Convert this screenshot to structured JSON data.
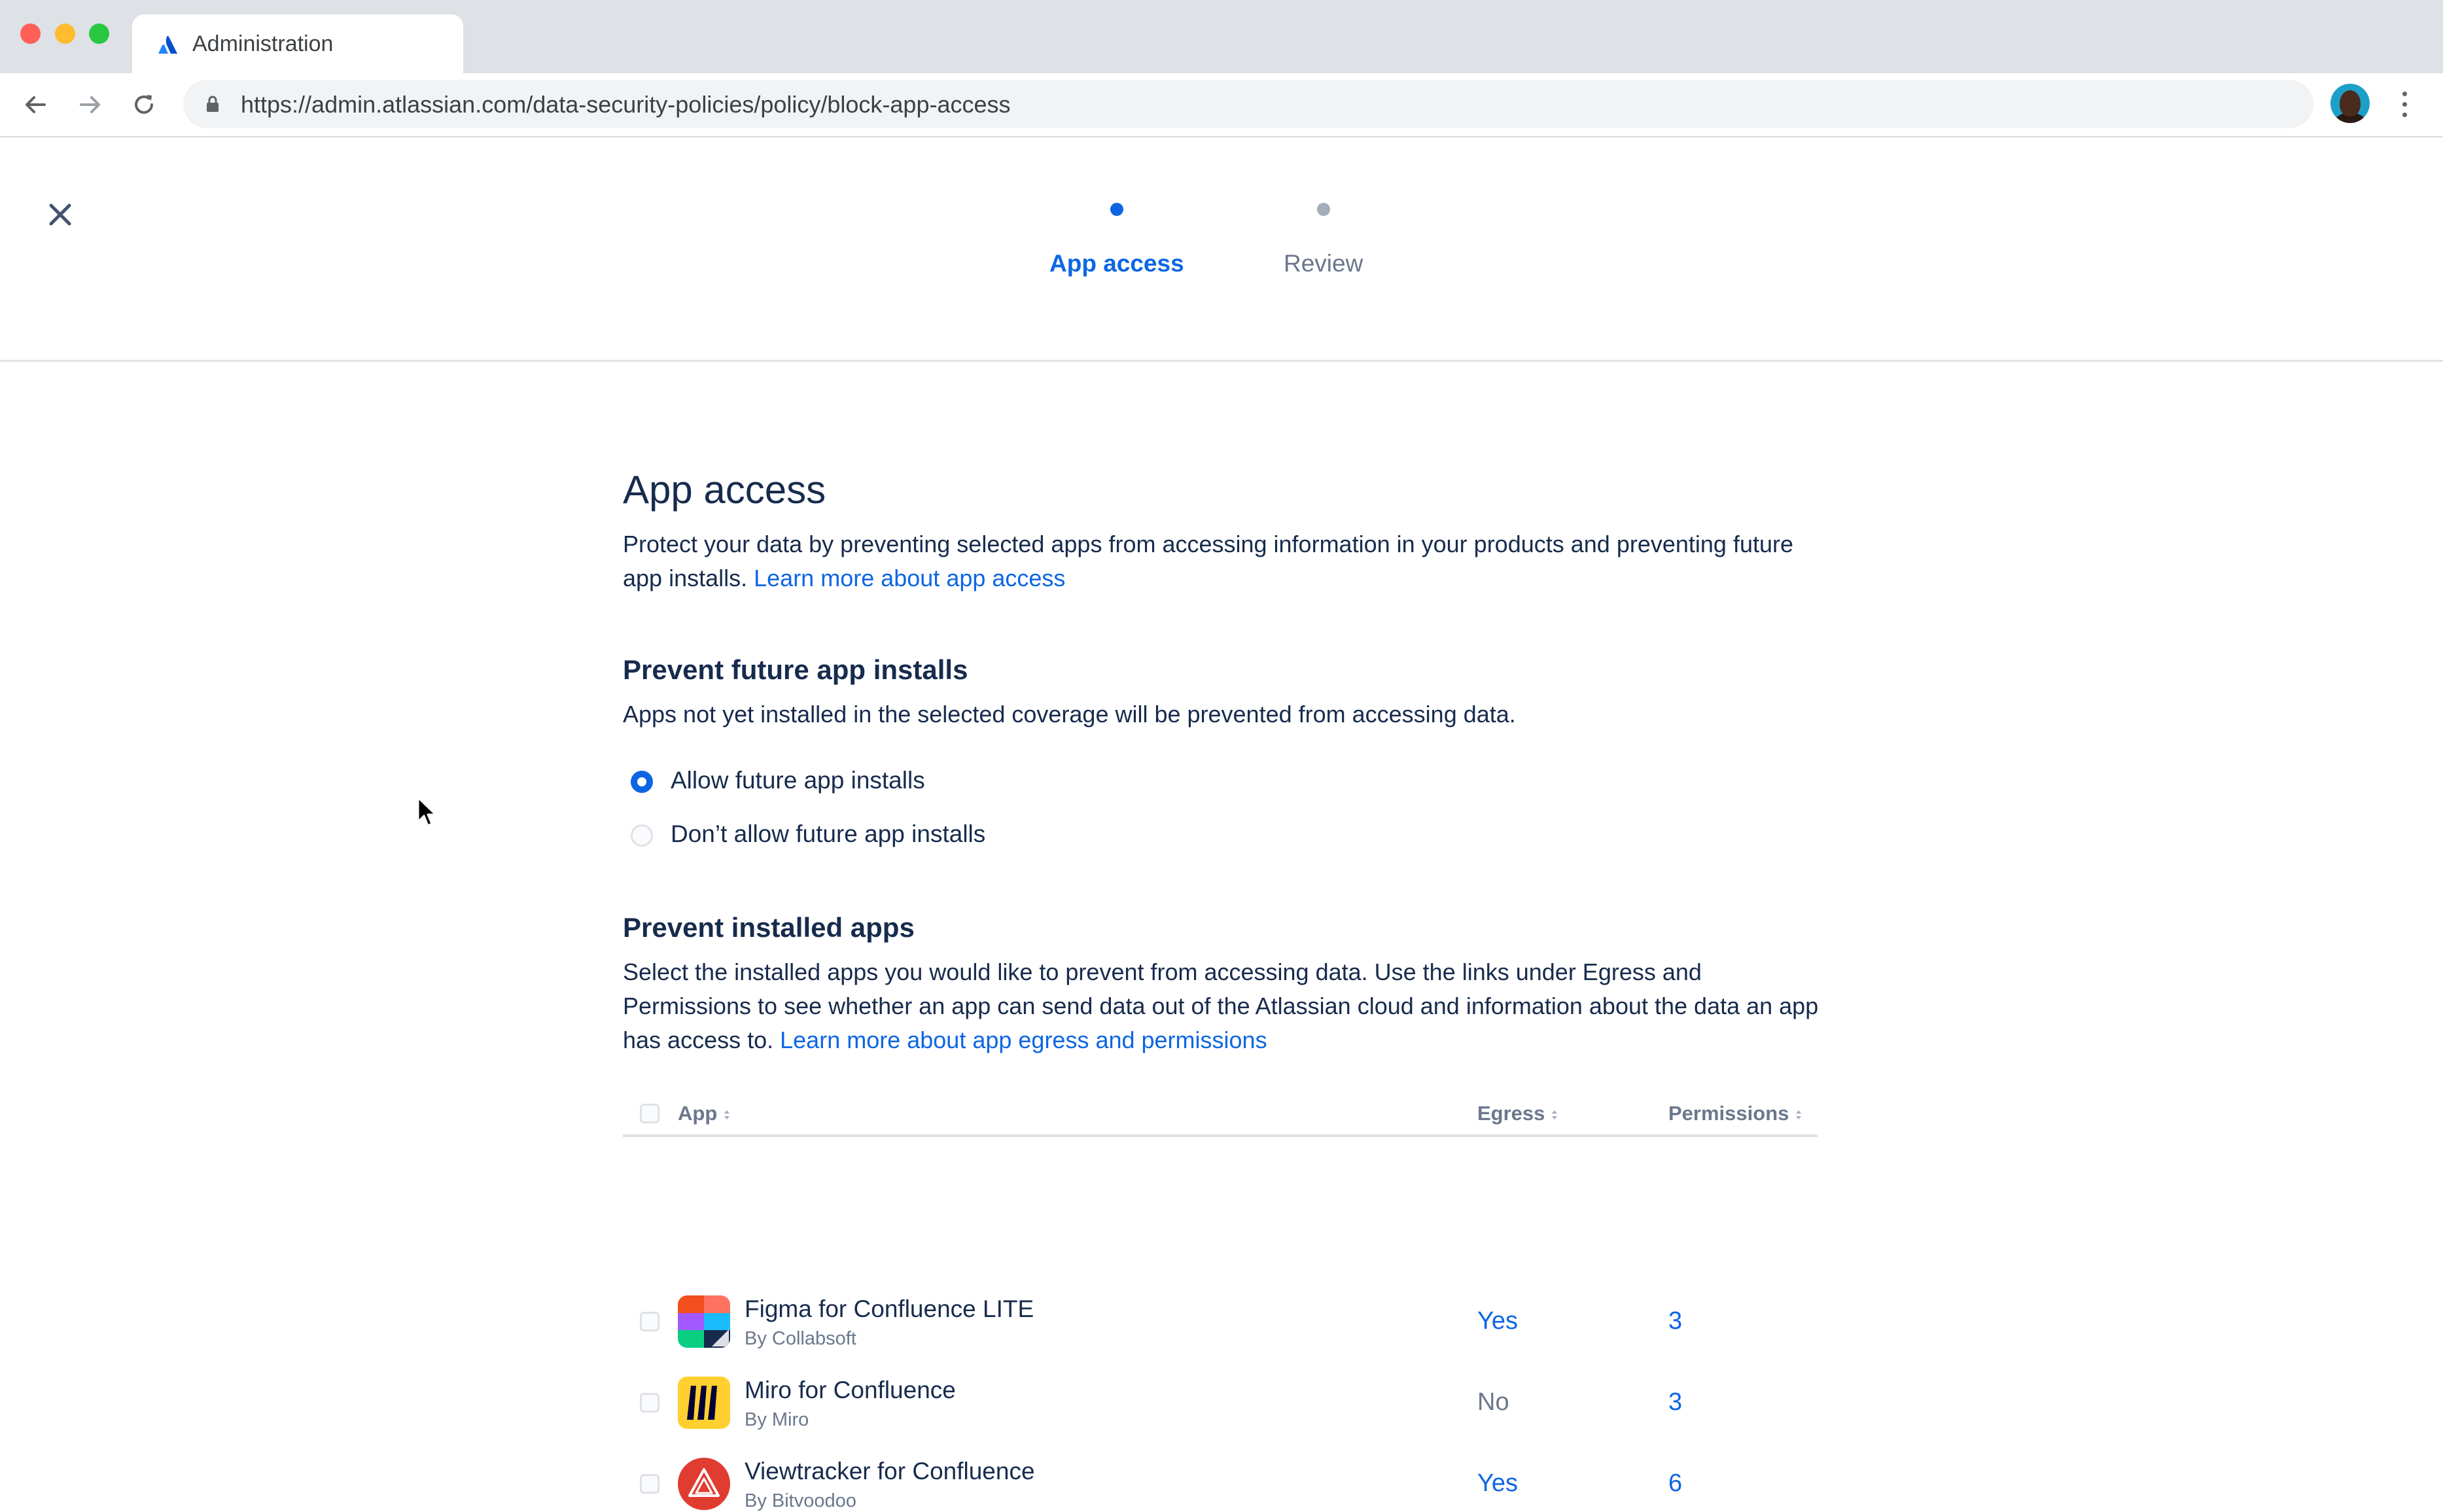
{
  "browser": {
    "tab_title": "Administration",
    "url": "https://admin.atlassian.com/data-security-policies/policy/block-app-access"
  },
  "stepper": {
    "steps": [
      {
        "label": "App access",
        "state": "active"
      },
      {
        "label": "Review",
        "state": "inactive"
      }
    ]
  },
  "intro": {
    "title": "App access",
    "description": "Protect your data by preventing selected apps from accessing information in your products and preventing future app installs.",
    "link": "Learn more about app access"
  },
  "future_installs": {
    "title": "Prevent future app installs",
    "description": "Apps not yet installed in the selected coverage will be prevented from accessing data.",
    "options": [
      {
        "label": "Allow future app installs",
        "selected": true
      },
      {
        "label": "Don’t allow future app installs",
        "selected": false
      }
    ]
  },
  "installed_apps": {
    "title": "Prevent installed apps",
    "description": "Select the installed apps you would like to prevent from accessing data. Use the links under Egress and Permissions to see whether an app can send data out of the Atlassian cloud and information about the data an app has access to.",
    "link": "Learn more about app egress and permissions",
    "columns": {
      "app": "App",
      "egress": "Egress",
      "permissions": "Permissions"
    },
    "rows": [
      {
        "name": "Figma for Confluence LITE",
        "vendor": "By Collabsoft",
        "egress": "Yes",
        "permissions": "3",
        "icon": "figma-icon"
      },
      {
        "name": "Miro for Confluence",
        "vendor": "By Miro",
        "egress": "No",
        "permissions": "3",
        "icon": "miro-icon"
      },
      {
        "name": "Viewtracker for Confluence",
        "vendor": "By Bitvoodoo",
        "egress": "Yes",
        "permissions": "6",
        "icon": "viewtracker-icon"
      }
    ]
  },
  "colors": {
    "accent": "#0c66e4",
    "text": "#172b4d",
    "subtle_text": "#6b778c",
    "divider": "#dfe1e6"
  }
}
